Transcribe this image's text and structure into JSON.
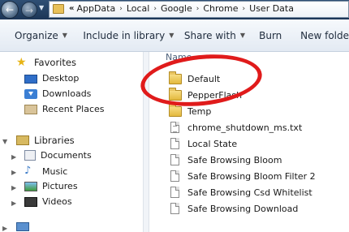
{
  "address_bar": {
    "lead": "«",
    "crumbs": [
      "AppData",
      "Local",
      "Google",
      "Chrome",
      "User Data"
    ],
    "separator": "›"
  },
  "toolbar": {
    "organize": "Organize",
    "include_in_library": "Include in library",
    "share_with": "Share with",
    "burn": "Burn",
    "new_folder": "New folde"
  },
  "navigation": {
    "favorites": "Favorites",
    "desktop": "Desktop",
    "downloads": "Downloads",
    "recent_places": "Recent Places",
    "libraries": "Libraries",
    "documents": "Documents",
    "music": "Music",
    "pictures": "Pictures",
    "videos": "Videos"
  },
  "content": {
    "column_header": "Name",
    "items": [
      {
        "name": "Default",
        "kind": "folder"
      },
      {
        "name": "PepperFlash",
        "kind": "folder"
      },
      {
        "name": "Temp",
        "kind": "folder"
      },
      {
        "name": "chrome_shutdown_ms.txt",
        "kind": "text-file"
      },
      {
        "name": "Local State",
        "kind": "file"
      },
      {
        "name": "Safe Browsing Bloom",
        "kind": "file"
      },
      {
        "name": "Safe Browsing Bloom Filter 2",
        "kind": "file"
      },
      {
        "name": "Safe Browsing Csd Whitelist",
        "kind": "file"
      },
      {
        "name": "Safe Browsing Download",
        "kind": "file"
      }
    ]
  },
  "annotation": {
    "color": "#e01b1b"
  }
}
